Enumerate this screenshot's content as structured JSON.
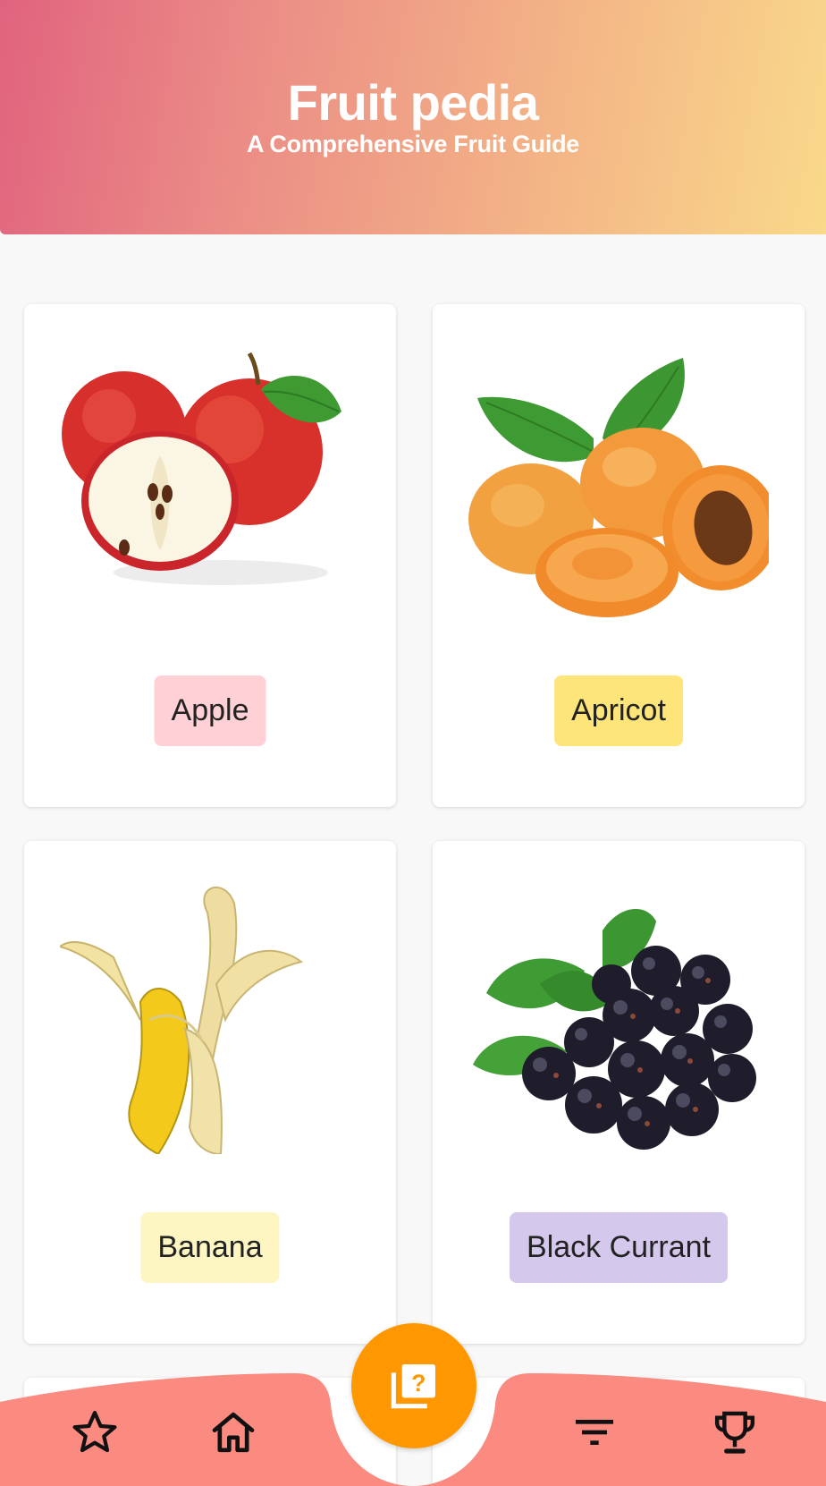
{
  "header": {
    "title": "Fruit pedia",
    "subtitle": "A Comprehensive Fruit Guide"
  },
  "fruits": [
    {
      "name": "Apple",
      "label_color": "#ffd0d6",
      "image": "apple-image"
    },
    {
      "name": "Apricot",
      "label_color": "#fde57a",
      "image": "apricot-image"
    },
    {
      "name": "Banana",
      "label_color": "#fdf6c2",
      "image": "banana-image"
    },
    {
      "name": "Black Currant",
      "label_color": "#d4c8ec",
      "image": "black-currant-image"
    }
  ],
  "bottom_nav": {
    "background_color": "#fb8a80",
    "fab_color": "#ff9800",
    "items": [
      {
        "icon": "star-icon"
      },
      {
        "icon": "home-icon"
      },
      {
        "icon": "quiz-icon"
      },
      {
        "icon": "filter-icon"
      },
      {
        "icon": "trophy-icon"
      }
    ]
  }
}
